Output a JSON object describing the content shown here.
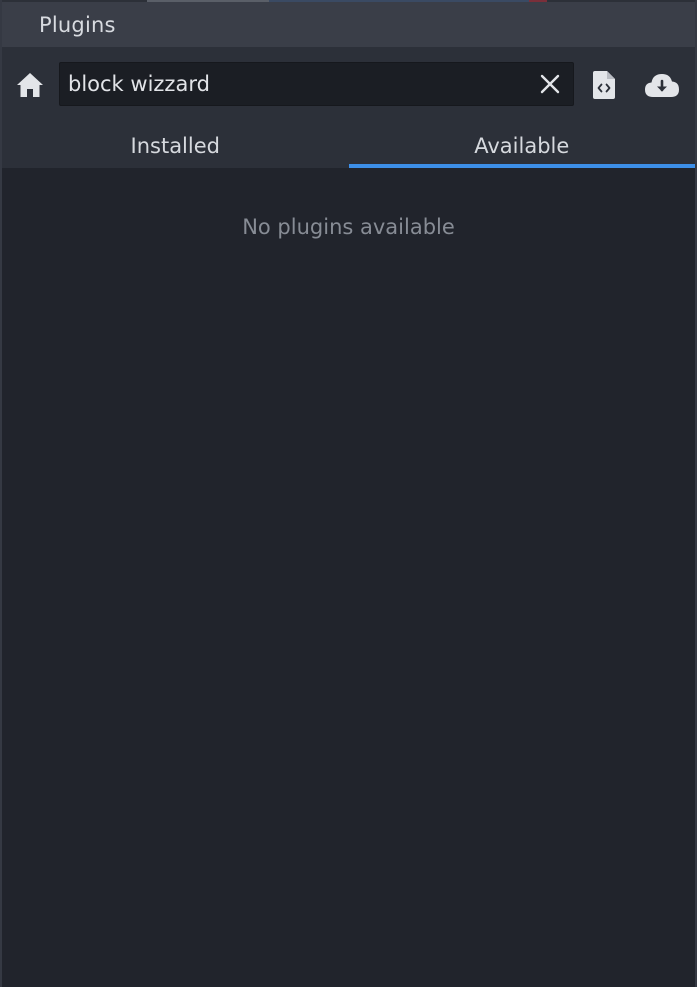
{
  "window": {
    "title": "Plugins"
  },
  "toolbar": {
    "home_icon": "home-icon",
    "search": {
      "value": "block wizzard",
      "placeholder": "",
      "clear_icon": "close-icon"
    },
    "file_icon": "file-code-icon",
    "download_icon": "cloud-download-icon"
  },
  "tabs": [
    {
      "label": "Installed",
      "active": false
    },
    {
      "label": "Available",
      "active": true
    }
  ],
  "content": {
    "empty_message": "No plugins available"
  },
  "colors": {
    "accent": "#3d8fe8",
    "background": "#21242c",
    "toolbar": "#2c3039",
    "titlebar": "#3a3e48",
    "text": "#d6d9de",
    "muted_text": "#878c95"
  }
}
